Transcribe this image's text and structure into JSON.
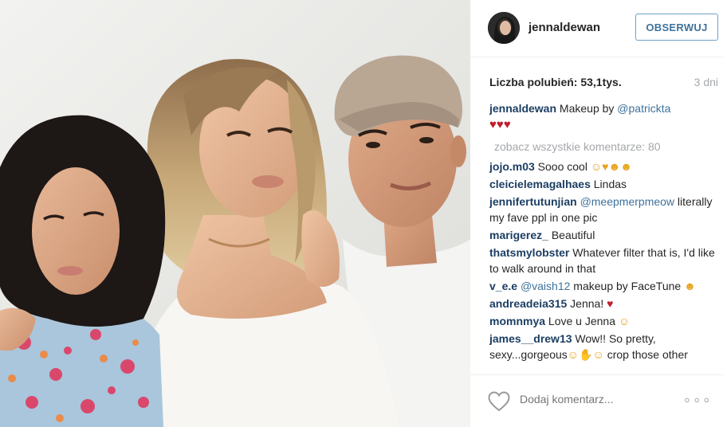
{
  "post": {
    "photo_icon": "post-photo",
    "username": "jennaldewan",
    "follow_label": "OBSERWUJ",
    "likes_label": "Liczba polubień: 53,1tys.",
    "age": "3 dni"
  },
  "caption": {
    "author": "jennaldewan",
    "text": " Makeup by ",
    "mention": "@patrickta",
    "hearts": "♥♥♥"
  },
  "view_all": "zobacz wszystkie komentarze: 80",
  "comments": [
    {
      "author": "jojo.m03",
      "pre": " Sooo cool ",
      "mention": "",
      "post": "",
      "emoji": "☺♥☻☻"
    },
    {
      "author": "cleicielemagalhaes",
      "pre": " Lindas",
      "mention": "",
      "post": "",
      "emoji": ""
    },
    {
      "author": "jennifertutunjian",
      "pre": " ",
      "mention": "@meepmerpmeow",
      "post": " literally my fave ppl in one pic",
      "emoji": ""
    },
    {
      "author": "marigerez_",
      "pre": " Beautiful",
      "mention": "",
      "post": "",
      "emoji": ""
    },
    {
      "author": "thatsmylobster",
      "pre": " Whatever filter that is, I'd like to walk around in that",
      "mention": "",
      "post": "",
      "emoji": ""
    },
    {
      "author": "v_e.e",
      "pre": " ",
      "mention": "@vaish12",
      "post": " makeup by FaceTune ",
      "emoji": "☻"
    },
    {
      "author": "andreadeia315",
      "pre": " Jenna! ",
      "mention": "",
      "post": "",
      "emoji": "♥"
    },
    {
      "author": "momnmya",
      "pre": " Love u Jenna ",
      "mention": "",
      "post": "",
      "emoji": "☺"
    },
    {
      "author": "james__drew13",
      "pre": " Wow!! So pretty, sexy...gorgeous",
      "mention": "",
      "post": " crop those other",
      "emoji": "☺✋☺"
    }
  ],
  "footer": {
    "like_icon": "heart-outline-icon",
    "placeholder": "Dodaj komentarz...",
    "more_icon": "more-options-icon",
    "more_glyph": "∘∘∘"
  },
  "colors": {
    "author": "#1c3e63",
    "mention": "#3f729b",
    "follow_border": "#70a0c6",
    "muted": "#a5a7aa"
  }
}
